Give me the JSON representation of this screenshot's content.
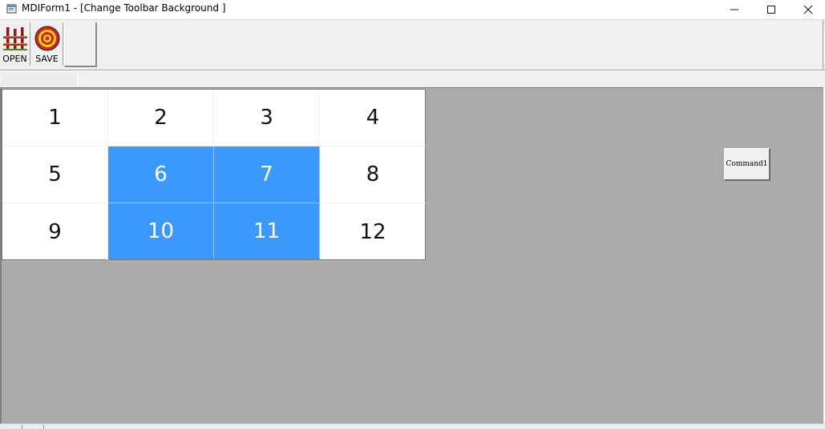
{
  "window": {
    "title": "MDIForm1 - [Change Toolbar Background ]",
    "icon": "app-form-icon",
    "controls": {
      "minimize": "minimize-icon",
      "maximize": "maximize-icon",
      "close": "close-icon"
    }
  },
  "toolbar": {
    "buttons": [
      {
        "label": "OPEN",
        "icon": "fence-icon"
      },
      {
        "label": "SAVE",
        "icon": "target-icon"
      }
    ]
  },
  "grid": {
    "rows": [
      [
        {
          "text": "1",
          "selected": false
        },
        {
          "text": "2",
          "selected": false
        },
        {
          "text": "3",
          "selected": false
        },
        {
          "text": "4",
          "selected": false
        }
      ],
      [
        {
          "text": "5",
          "selected": false
        },
        {
          "text": "6",
          "selected": true
        },
        {
          "text": "7",
          "selected": true
        },
        {
          "text": "8",
          "selected": false
        }
      ],
      [
        {
          "text": "9",
          "selected": false
        },
        {
          "text": "10",
          "selected": true
        },
        {
          "text": "11",
          "selected": true
        },
        {
          "text": "12",
          "selected": false
        }
      ]
    ],
    "selection_color": "#3b99fc"
  },
  "command_button": {
    "label": "Command1"
  },
  "colors": {
    "mdi_background": "#ababab",
    "toolbar_background": "#f0f0f0"
  }
}
